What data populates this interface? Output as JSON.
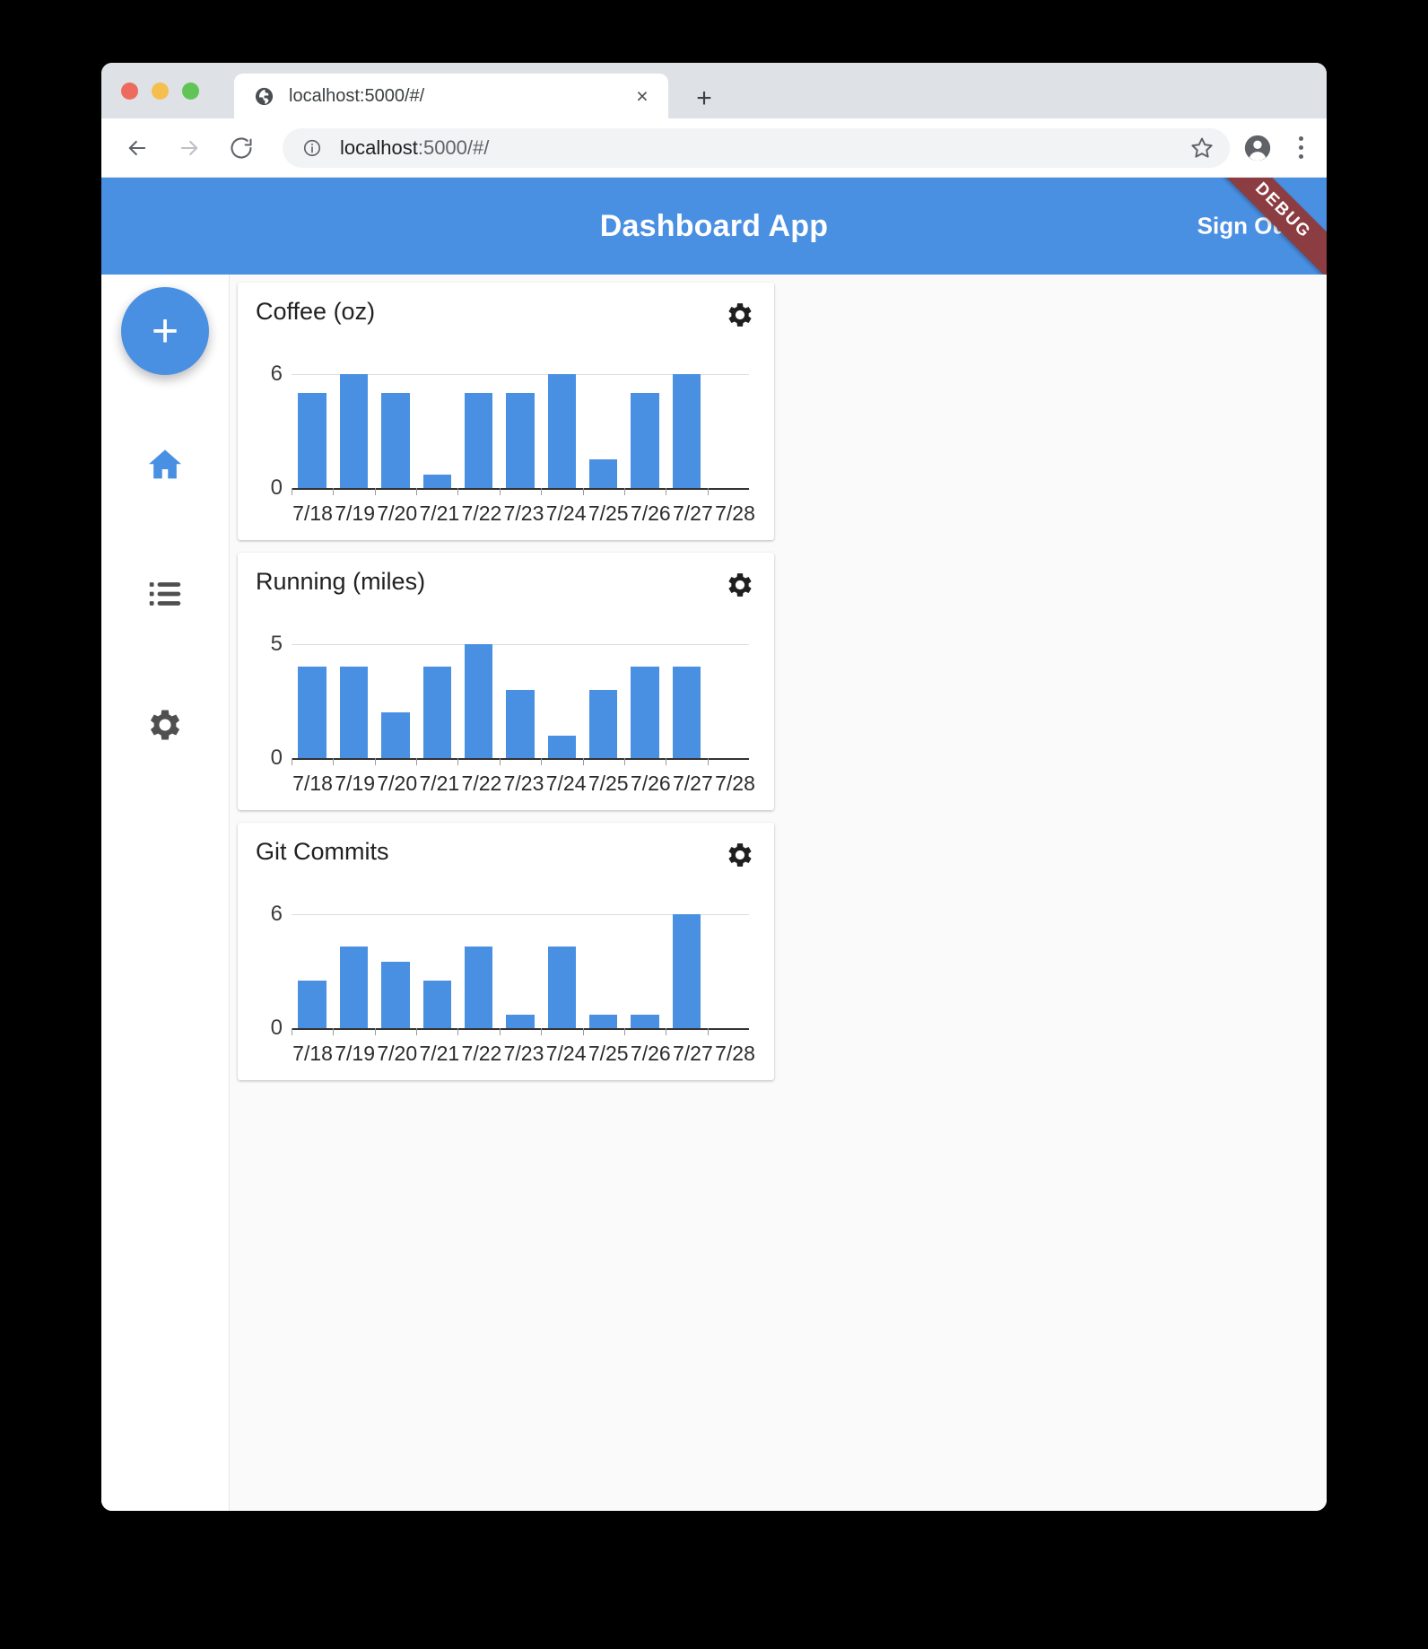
{
  "browser": {
    "traffic_lights": [
      "close",
      "minimize",
      "maximize"
    ],
    "tab": {
      "title": "localhost:5000/#/",
      "favicon": "globe-icon",
      "close_label": "×"
    },
    "new_tab_label": "+",
    "toolbar": {
      "back_label": "←",
      "forward_label": "→",
      "reload_label": "↻",
      "url_host": "localhost",
      "url_rest": ":5000/#/",
      "url_full": "localhost:5000/#/",
      "star_icon": "star-icon",
      "profile_icon": "avatar-icon",
      "menu_icon": "kebab-menu-icon"
    }
  },
  "app": {
    "title": "Dashboard App",
    "sign_out_label": "Sign Out",
    "debug_ribbon": "DEBUG",
    "colors": {
      "primary": "#4a90e2",
      "bar": "#4a90e2",
      "ribbon": "#8c3d42",
      "background": "#fafafa"
    },
    "sidebar": {
      "add_label": "+",
      "items": [
        {
          "name": "home",
          "icon": "home-icon",
          "active": true
        },
        {
          "name": "list",
          "icon": "list-icon",
          "active": false
        },
        {
          "name": "settings",
          "icon": "gear-icon",
          "active": false
        }
      ]
    }
  },
  "chart_data": [
    {
      "type": "bar",
      "title": "Coffee (oz)",
      "xlabel": "",
      "ylabel": "",
      "ylim": [
        0,
        6
      ],
      "yticks": [
        "0",
        "6"
      ],
      "grid": true,
      "legend": "none",
      "categories": [
        "7/18",
        "7/19",
        "7/20",
        "7/21",
        "7/22",
        "7/23",
        "7/24",
        "7/25",
        "7/26",
        "7/27",
        "7/28"
      ],
      "values": [
        5,
        6,
        5,
        0.7,
        5,
        5,
        6,
        1.5,
        5,
        6,
        0
      ],
      "settings_icon": "gear-icon"
    },
    {
      "type": "bar",
      "title": "Running (miles)",
      "xlabel": "",
      "ylabel": "",
      "ylim": [
        0,
        5
      ],
      "yticks": [
        "0",
        "5"
      ],
      "grid": true,
      "legend": "none",
      "categories": [
        "7/18",
        "7/19",
        "7/20",
        "7/21",
        "7/22",
        "7/23",
        "7/24",
        "7/25",
        "7/26",
        "7/27",
        "7/28"
      ],
      "values": [
        4,
        4,
        2,
        4,
        5,
        3,
        1,
        3,
        4,
        4,
        0
      ],
      "settings_icon": "gear-icon"
    },
    {
      "type": "bar",
      "title": "Git Commits",
      "xlabel": "",
      "ylabel": "",
      "ylim": [
        0,
        6
      ],
      "yticks": [
        "0",
        "6"
      ],
      "grid": true,
      "legend": "none",
      "categories": [
        "7/18",
        "7/19",
        "7/20",
        "7/21",
        "7/22",
        "7/23",
        "7/24",
        "7/25",
        "7/26",
        "7/27",
        "7/28"
      ],
      "values": [
        2.5,
        4.3,
        3.5,
        2.5,
        4.3,
        0.7,
        4.3,
        0.7,
        0.7,
        6,
        0
      ],
      "settings_icon": "gear-icon"
    }
  ]
}
